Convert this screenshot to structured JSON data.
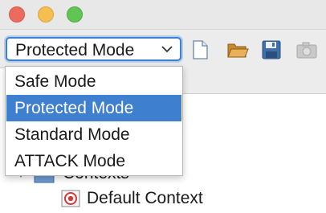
{
  "window": {
    "controls": [
      "close",
      "minimize",
      "zoom"
    ]
  },
  "toolbar": {
    "mode_select": {
      "value": "Protected Mode",
      "options": [
        "Safe Mode",
        "Protected Mode",
        "Standard Mode",
        "ATTACK Mode"
      ],
      "selected_index": 1
    },
    "icons": [
      "new-session-icon",
      "open-session-icon",
      "save-session-icon",
      "snapshot-icon"
    ]
  },
  "tree": {
    "contexts_label": "Contexts",
    "default_context_label": "Default Context"
  },
  "colors": {
    "selection": "#3e7fd0",
    "focus_ring": "#3d7fd6"
  }
}
